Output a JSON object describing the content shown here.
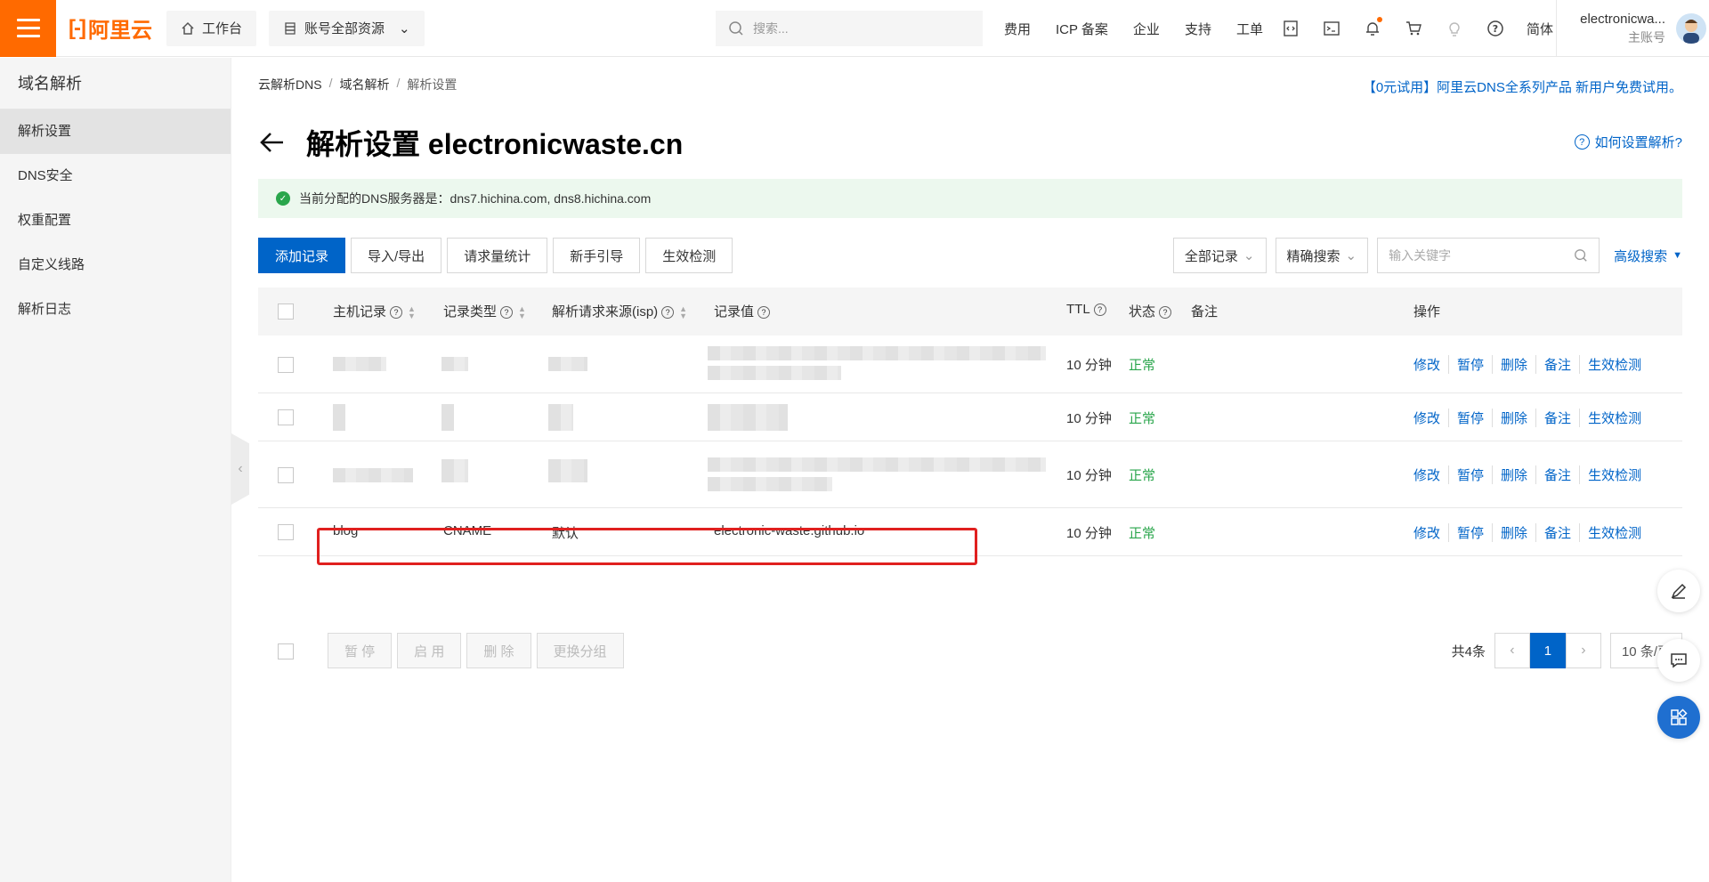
{
  "topbar": {
    "logo_text": "阿里云",
    "workbench": "工作台",
    "resources": "账号全部资源",
    "search_placeholder": "搜索...",
    "links": [
      "费用",
      "ICP 备案",
      "企业",
      "支持",
      "工单"
    ],
    "lang": "简体",
    "user_name": "electronicwa...",
    "user_role": "主账号"
  },
  "sidebar": {
    "title": "域名解析",
    "items": [
      "解析设置",
      "DNS安全",
      "权重配置",
      "自定义线路",
      "解析日志"
    ]
  },
  "breadcrumb": [
    "云解析DNS",
    "域名解析",
    "解析设置"
  ],
  "promo": "【0元试用】阿里云DNS全系列产品 新用户免费试用。",
  "page_title": "解析设置 electronicwaste.cn",
  "help_link": "如何设置解析?",
  "notice": "当前分配的DNS服务器是：dns7.hichina.com, dns8.hichina.com",
  "toolbar": [
    "添加记录",
    "导入/导出",
    "请求量统计",
    "新手引导",
    "生效检测"
  ],
  "filters": {
    "all_records": "全部记录",
    "exact_search": "精确搜索",
    "keyword_placeholder": "输入关键字",
    "advanced": "高级搜索"
  },
  "table": {
    "headers": [
      "主机记录",
      "记录类型",
      "解析请求来源(isp)",
      "记录值",
      "TTL",
      "状态",
      "备注",
      "操作"
    ],
    "rows": [
      {
        "host": "",
        "type": "",
        "isp": "",
        "value": "",
        "ttl": "10 分钟",
        "status": "正常"
      },
      {
        "host": "",
        "type": "",
        "isp": "",
        "value": "",
        "ttl": "10 分钟",
        "status": "正常"
      },
      {
        "host": "",
        "type": "",
        "isp": "",
        "value": "",
        "ttl": "10 分钟",
        "status": "正常"
      },
      {
        "host": "blog",
        "type": "CNAME",
        "isp": "默认",
        "value": "electronic-waste.github.io",
        "ttl": "10 分钟",
        "status": "正常"
      }
    ],
    "ops": [
      "修改",
      "暂停",
      "删除",
      "备注",
      "生效检测"
    ]
  },
  "batch": [
    "暂 停",
    "启 用",
    "删 除",
    "更换分组"
  ],
  "pager": {
    "total": "共4条",
    "page": "1",
    "size": "10 条/页"
  },
  "colors": {
    "brand": "#ff6a00",
    "link": "#0064c8",
    "ok": "#2aa64c",
    "highlight": "#e0201f"
  }
}
